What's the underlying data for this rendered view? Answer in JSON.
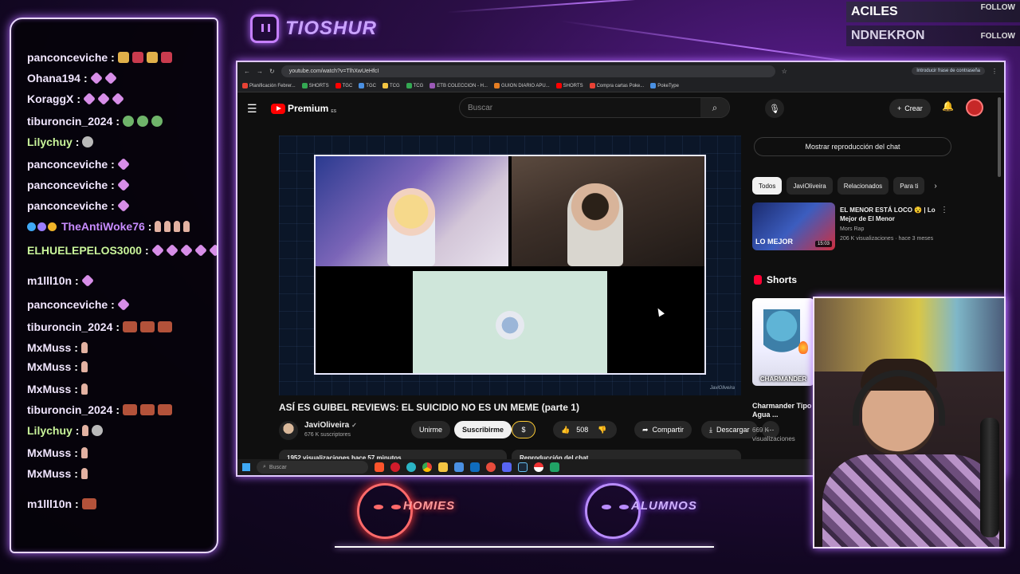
{
  "brand": {
    "name": "TIOSHUR"
  },
  "follows": [
    {
      "name": "ACILES",
      "tag": "FOLLOW"
    },
    {
      "name": "NDNEKRON",
      "tag": "FOLLOW"
    }
  ],
  "chat": {
    "messages": [
      {
        "user": "panconceviche",
        "emotes": [
          "gold",
          "red",
          "gold",
          "red"
        ]
      },
      {
        "user": "Ohana194",
        "emotes": [
          "pink",
          "pink"
        ]
      },
      {
        "user": "KoraggX",
        "emotes": [
          "pink",
          "pink",
          "pink"
        ]
      },
      {
        "user": "tiburoncin_2024",
        "emotes": [
          "frog",
          "frog",
          "frog"
        ]
      },
      {
        "user": "Lilychuy",
        "emotes": [
          "gray"
        ]
      },
      {
        "user": "panconceviche",
        "emotes": [
          "pink"
        ]
      },
      {
        "user": "panconceviche",
        "emotes": [
          "pink"
        ]
      },
      {
        "user": "panconceviche",
        "emotes": [
          "pink"
        ]
      },
      {
        "user": "TheAntiWoke76",
        "emotes": [
          "hand",
          "hand",
          "hand",
          "hand"
        ]
      },
      {
        "user": "ELHUELEPELOS3000",
        "emotes": [
          "pink",
          "pink",
          "pink",
          "pink",
          "pink"
        ]
      },
      {
        "user": "m1lll10n",
        "emotes": [
          "pink"
        ]
      },
      {
        "user": "panconceviche",
        "emotes": [
          "pink"
        ]
      },
      {
        "user": "tiburoncin_2024",
        "emotes": [
          "brick",
          "brick",
          "brick"
        ]
      },
      {
        "user": "MxMuss",
        "emotes": [
          "hand"
        ]
      },
      {
        "user": "MxMuss",
        "emotes": [
          "hand"
        ]
      },
      {
        "user": "MxMuss",
        "emotes": [
          "hand"
        ]
      },
      {
        "user": "tiburoncin_2024",
        "emotes": [
          "brick",
          "brick",
          "brick"
        ]
      },
      {
        "user": "Lilychuy",
        "emotes": [
          "hand",
          "gray"
        ]
      },
      {
        "user": "MxMuss",
        "emotes": [
          "hand"
        ]
      },
      {
        "user": "MxMuss",
        "emotes": [
          "hand"
        ]
      },
      {
        "user": "m1lll10n",
        "emotes": [
          "brick"
        ]
      }
    ]
  },
  "browser": {
    "url": "youtube.com/watch?v=TlhXwUeHfcI",
    "password_prompt": "Introducir frase de contraseña",
    "bookmarks": [
      "Planificación Febrer...",
      "SHORTS",
      "TGC",
      "TGC",
      "TCG",
      "TCG",
      "ETB COLECCION - H...",
      "GUION DIARIO APU...",
      "SHORTS",
      "Compra cartas Poke...",
      "PokeType"
    ]
  },
  "youtube": {
    "logo_text": "Premium",
    "logo_region": "ES",
    "search_placeholder": "Buscar",
    "create_label": "Crear",
    "video": {
      "title": "ASÍ ES GUIBEL REVIEWS: EL SUICIDIO NO ES UN MEME (parte 1)",
      "channel": "JaviOliveira",
      "subscribers": "676 K suscriptores",
      "join_label": "Unirme",
      "subscribe_label": "Suscribirme",
      "thanks_label": "$",
      "likes": "508",
      "share_label": "Compartir",
      "download_label": "Descargar",
      "views_line": "1952 visualizaciones  hace 57 minutos",
      "replay_label": "Reproducción del chat",
      "watermark": "JaviOliveira"
    },
    "sidebar": {
      "show_chat_label": "Mostrar reproducción del chat",
      "chips": [
        "Todos",
        "JaviOliveira",
        "Relacionados",
        "Para ti"
      ],
      "recommended": {
        "title": "EL MENOR ESTÁ LOCO 😵 | Lo Mejor de El Menor",
        "channel": "Mors Rap",
        "meta": "206 K visualizaciones · hace 3 meses",
        "duration": "15:03",
        "thumb_text": "LO MEJOR"
      },
      "shorts_heading": "Shorts",
      "short": {
        "label": "CHARMANDER",
        "title": "Charmander Tipo Agua ...",
        "views": "669 K visualizaciones"
      }
    }
  },
  "taskbar": {
    "search_placeholder": "Buscar"
  },
  "bottom_logos": [
    {
      "text": "HOMIES",
      "color": "#ff3b3b"
    },
    {
      "text": "ALUMNOS",
      "color": "#8f4dff"
    }
  ]
}
